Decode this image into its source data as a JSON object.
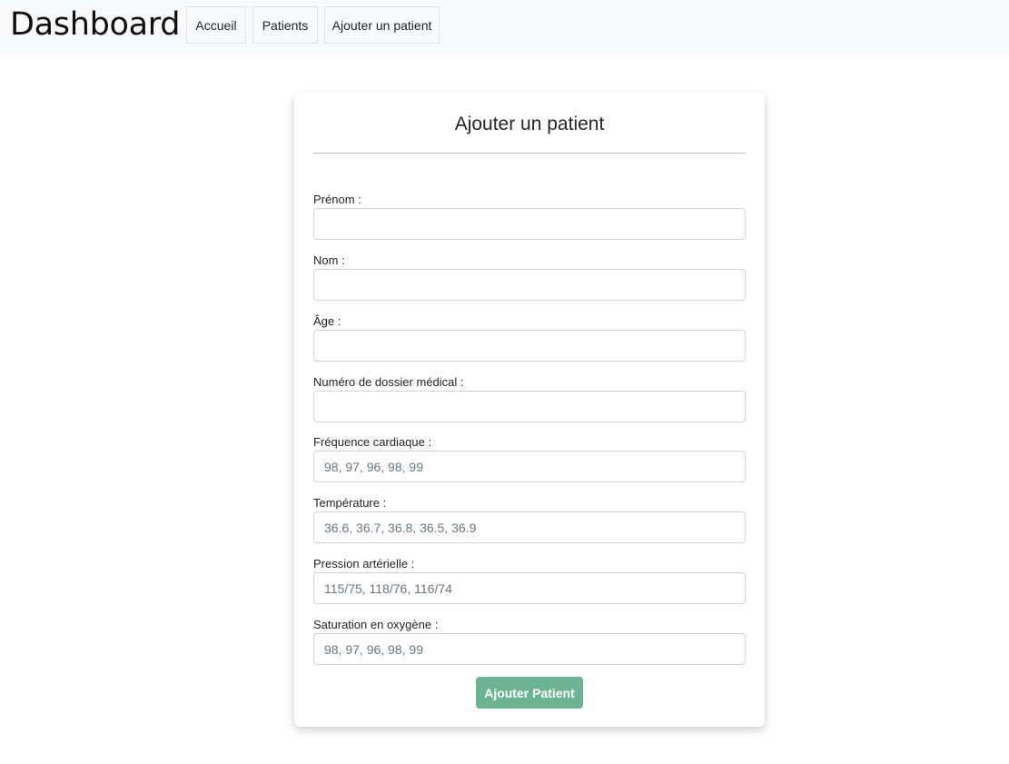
{
  "header": {
    "brand": "Dashboard",
    "nav": [
      {
        "label": "Accueil"
      },
      {
        "label": "Patients"
      },
      {
        "label": "Ajouter un patient"
      }
    ]
  },
  "form": {
    "title": "Ajouter un patient",
    "fields": [
      {
        "label": "Prénom :",
        "value": "",
        "placeholder": ""
      },
      {
        "label": "Nom :",
        "value": "",
        "placeholder": ""
      },
      {
        "label": "Âge :",
        "value": "",
        "placeholder": ""
      },
      {
        "label": "Numéro de dossier médical :",
        "value": "",
        "placeholder": ""
      },
      {
        "label": "Fréquence cardiaque :",
        "value": "",
        "placeholder": "98, 97, 96, 98, 99"
      },
      {
        "label": "Température :",
        "value": "",
        "placeholder": "36.6, 36.7, 36.8, 36.5, 36.9"
      },
      {
        "label": "Pression artérielle :",
        "value": "",
        "placeholder": "115/75, 118/76, 116/74"
      },
      {
        "label": "Saturation en oxygène :",
        "value": "",
        "placeholder": "98, 97, 96, 98, 99"
      }
    ],
    "submit_label": "Ajouter Patient",
    "accent_color": "#6cb392"
  }
}
